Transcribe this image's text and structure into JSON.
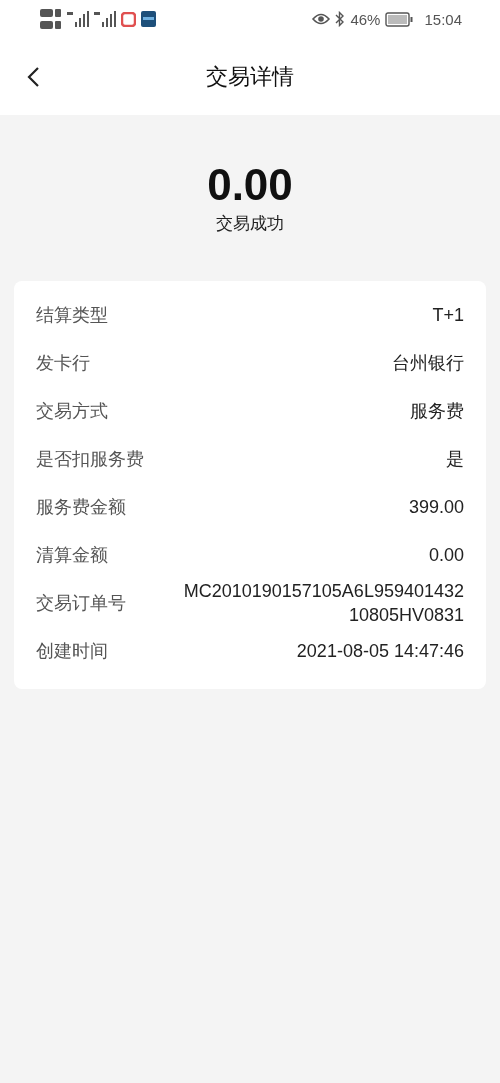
{
  "status_bar": {
    "battery": "46%",
    "time": "15:04"
  },
  "header": {
    "title": "交易详情"
  },
  "summary": {
    "amount": "0.00",
    "status": "交易成功"
  },
  "details": [
    {
      "label": "结算类型",
      "value": "T+1"
    },
    {
      "label": "发卡行",
      "value": "台州银行"
    },
    {
      "label": "交易方式",
      "value": "服务费"
    },
    {
      "label": "是否扣服务费",
      "value": "是"
    },
    {
      "label": "服务费金额",
      "value": "399.00"
    },
    {
      "label": "清算金额",
      "value": "0.00"
    },
    {
      "label": "交易订单号",
      "value": "MC2010190157105A6L95940143210805HV0831"
    },
    {
      "label": "创建时间",
      "value": "2021-08-05 14:47:46"
    }
  ]
}
